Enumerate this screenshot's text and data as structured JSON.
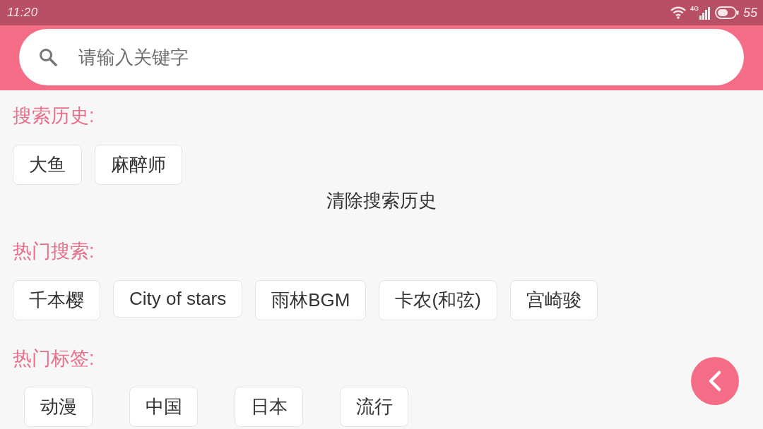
{
  "status_bar": {
    "time": "11:20",
    "network": "4G",
    "battery": "55"
  },
  "search": {
    "placeholder": "请输入关键字"
  },
  "sections": [
    {
      "kind": "chips",
      "title": "搜索历史:",
      "items": [
        "大鱼",
        "麻醉师"
      ],
      "action": "清除搜索历史"
    },
    {
      "kind": "chips",
      "title": "热门搜索:",
      "items": [
        "千本樱",
        "City of stars",
        "雨林BGM",
        "卡农(和弦)",
        "宫崎骏"
      ]
    },
    {
      "kind": "tags",
      "title": "热门标签:",
      "items": [
        "动漫",
        "中国",
        "日本",
        "流行"
      ]
    }
  ]
}
